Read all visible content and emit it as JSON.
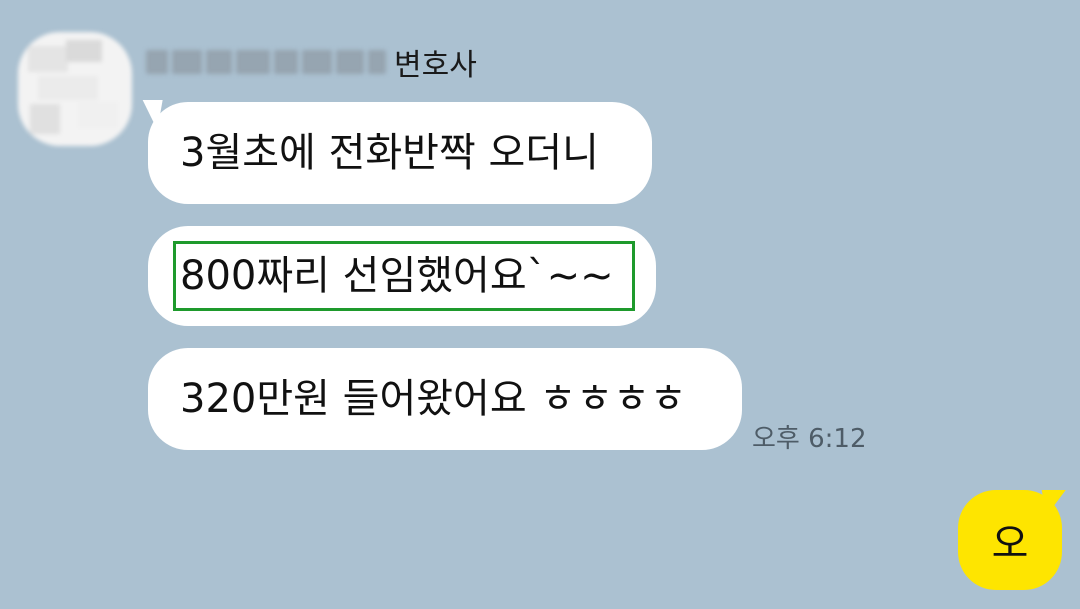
{
  "sender": {
    "role": "변호사"
  },
  "messages": [
    {
      "text": "3월초에 전화반짝 오더니"
    },
    {
      "text": "800짜리 선임했어요`~~"
    },
    {
      "text": "320만원 들어왔어요 ㅎㅎㅎㅎ"
    }
  ],
  "timestamp": "오후 6:12",
  "my_message": {
    "text": "오"
  },
  "colors": {
    "background": "#abc1d1",
    "incoming_bubble": "#ffffff",
    "outgoing_bubble": "#fee500",
    "highlight_border": "#1e9a2c"
  }
}
